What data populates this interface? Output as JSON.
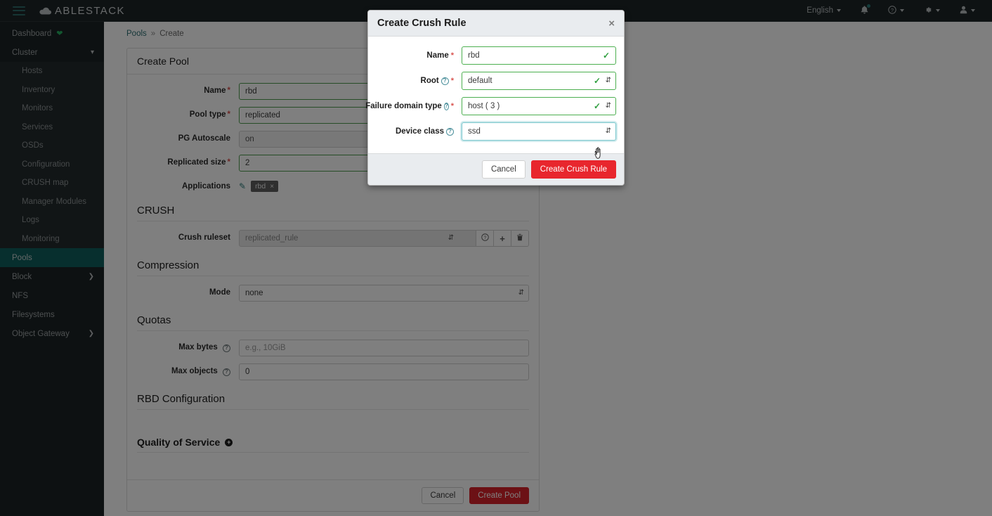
{
  "topbar": {
    "brand": "ABLESTACK",
    "menu_icon": "hamburger-icon",
    "language": "English",
    "notifications_icon": "bell-icon",
    "help_icon": "question-circle-icon",
    "settings_icon": "gear-icon",
    "user_icon": "user-icon"
  },
  "sidebar": {
    "dashboard": {
      "label": "Dashboard",
      "health_icon": "heart-icon"
    },
    "cluster": {
      "label": "Cluster",
      "expanded": true
    },
    "cluster_items": [
      {
        "label": "Hosts"
      },
      {
        "label": "Inventory"
      },
      {
        "label": "Monitors"
      },
      {
        "label": "Services"
      },
      {
        "label": "OSDs"
      },
      {
        "label": "Configuration"
      },
      {
        "label": "CRUSH map"
      },
      {
        "label": "Manager Modules"
      },
      {
        "label": "Logs"
      },
      {
        "label": "Monitoring"
      }
    ],
    "items": [
      {
        "label": "Pools",
        "active": true,
        "chevron": false
      },
      {
        "label": "Block",
        "active": false,
        "chevron": true
      },
      {
        "label": "NFS",
        "active": false,
        "chevron": false
      },
      {
        "label": "Filesystems",
        "active": false,
        "chevron": false
      },
      {
        "label": "Object Gateway",
        "active": false,
        "chevron": true
      }
    ]
  },
  "breadcrumb": {
    "root": "Pools",
    "separator": "»",
    "current": "Create"
  },
  "pool_form": {
    "title": "Create Pool",
    "fields": {
      "name": {
        "label": "Name",
        "required": true,
        "value": "rbd"
      },
      "pool_type": {
        "label": "Pool type",
        "required": true,
        "value": "replicated"
      },
      "pg_autoscale": {
        "label": "PG Autoscale",
        "required": false,
        "value": "on"
      },
      "replicated_size": {
        "label": "Replicated size",
        "required": true,
        "value": "2"
      },
      "applications": {
        "label": "Applications",
        "chip": "rbd",
        "chip_remove": "×",
        "edit_icon": "pencil-icon"
      }
    },
    "crush": {
      "heading": "CRUSH",
      "ruleset_label": "Crush ruleset",
      "ruleset_value": "replicated_rule",
      "buttons": [
        {
          "icon": "question-circle-icon"
        },
        {
          "icon": "plus-icon",
          "glyph": "+"
        },
        {
          "icon": "trash-icon"
        }
      ]
    },
    "compression": {
      "heading": "Compression",
      "mode_label": "Mode",
      "mode_value": "none"
    },
    "quotas": {
      "heading": "Quotas",
      "max_bytes_label": "Max bytes",
      "max_bytes_placeholder": "e.g., 10GiB",
      "max_objects_label": "Max objects",
      "max_objects_value": "0"
    },
    "rbd_config": {
      "heading": "RBD Configuration"
    },
    "qos": {
      "heading": "Quality of Service",
      "add_icon": "plus-circle-icon"
    },
    "footer": {
      "cancel": "Cancel",
      "submit": "Create Pool"
    }
  },
  "modal": {
    "title": "Create Crush Rule",
    "close_icon": "close-icon",
    "fields": {
      "name": {
        "label": "Name",
        "required": true,
        "value": "rbd",
        "valid": true
      },
      "root": {
        "label": "Root",
        "required": true,
        "value": "default",
        "valid": true,
        "help": true
      },
      "failure_domain": {
        "label": "Failure domain type",
        "required": true,
        "value": "host ( 3 )",
        "valid": true,
        "help": true
      },
      "device_class": {
        "label": "Device class",
        "required": false,
        "value": "ssd",
        "focused": true,
        "help": true
      }
    },
    "footer": {
      "cancel": "Cancel",
      "submit": "Create Crush Rule"
    }
  },
  "colors": {
    "sidebar_bg": "#1b2224",
    "topbar_bg": "#1d2427",
    "active_nav": "#0e5f5c",
    "accent_teal": "#2b7a78",
    "danger_red": "#e8262d",
    "pool_submit_red": "#d9232a",
    "valid_green": "#4caf50",
    "focus_teal": "#79c6cc"
  }
}
